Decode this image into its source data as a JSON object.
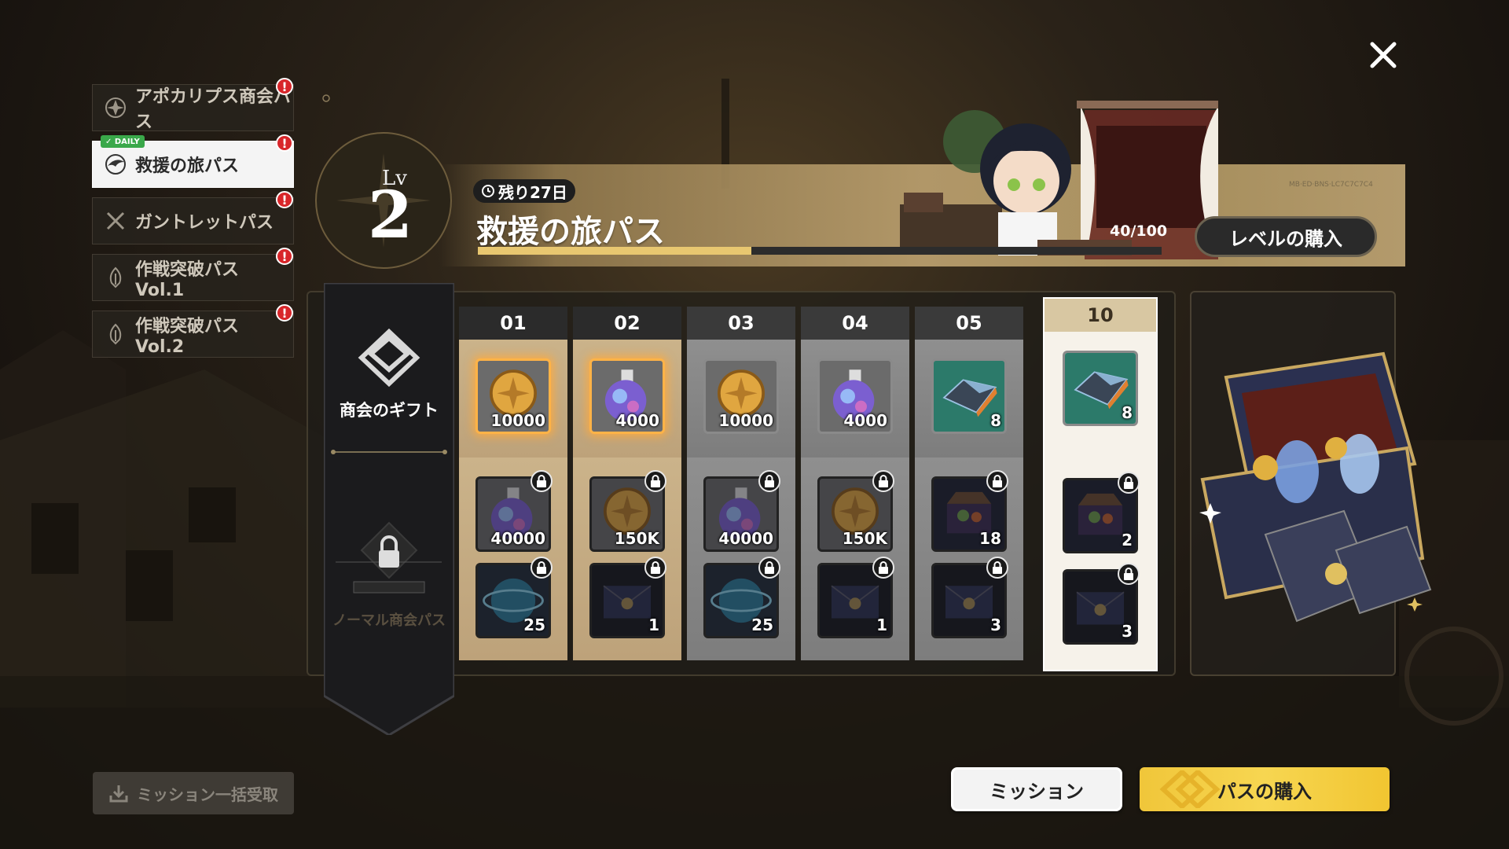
{
  "tabs": [
    {
      "label": "アポカリプス商会パス",
      "icon": "star-emblem-icon",
      "badge": "!"
    },
    {
      "label": "救援の旅パス",
      "icon": "wing-emblem-icon",
      "badge": "!",
      "tag": "DAILY"
    },
    {
      "label": "ガントレットパス",
      "icon": "crossed-swords-icon",
      "badge": "!"
    },
    {
      "label": "作戦突破パス Vol.1",
      "icon": "flame-emblem-icon",
      "badge": "!"
    },
    {
      "label": "作戦突破パス Vol.2",
      "icon": "flame-emblem-icon",
      "badge": "!"
    }
  ],
  "level": {
    "label": "Lv",
    "value": "2"
  },
  "header": {
    "timer": "残り27日",
    "title": "救援の旅パス",
    "exp": "40/100",
    "exp_progress": 0.4,
    "buy_level": "レベルの購入"
  },
  "gift": {
    "title": "商会のギフト",
    "normal_label": "ノーマル商会パス"
  },
  "columns": [
    {
      "head": "01",
      "free": {
        "icon": "gold-coin",
        "qty": "10000"
      },
      "prem": [
        {
          "icon": "potion",
          "qty": "40000"
        },
        {
          "icon": "orb",
          "qty": "25"
        }
      ]
    },
    {
      "head": "02",
      "free": {
        "icon": "potion",
        "qty": "4000"
      },
      "prem": [
        {
          "icon": "gold-coin",
          "qty": "150K"
        },
        {
          "icon": "envelope",
          "qty": "1"
        }
      ]
    },
    {
      "head": "03",
      "free": {
        "icon": "gold-coin",
        "qty": "10000"
      },
      "prem": [
        {
          "icon": "potion",
          "qty": "40000"
        },
        {
          "icon": "orb",
          "qty": "25"
        }
      ]
    },
    {
      "head": "04",
      "free": {
        "icon": "potion",
        "qty": "4000"
      },
      "prem": [
        {
          "icon": "gold-coin",
          "qty": "150K"
        },
        {
          "icon": "envelope",
          "qty": "1"
        }
      ]
    },
    {
      "head": "05",
      "free": {
        "icon": "crystal",
        "qty": "8"
      },
      "prem": [
        {
          "icon": "chest",
          "qty": "18"
        },
        {
          "icon": "envelope",
          "qty": "3"
        }
      ]
    },
    {
      "head": "10",
      "free": {
        "icon": "crystal",
        "qty": "8"
      },
      "prem": [
        {
          "icon": "chest",
          "qty": "2"
        },
        {
          "icon": "envelope",
          "qty": "3"
        }
      ]
    }
  ],
  "buttons": {
    "collect_all": "ミッション一括受取",
    "mission": "ミッション",
    "buy_pass": "パスの購入"
  },
  "colors": {
    "accent_gold": "#e8c770",
    "badge_red": "#d8262a",
    "buy_yellow": "#f7d651"
  }
}
